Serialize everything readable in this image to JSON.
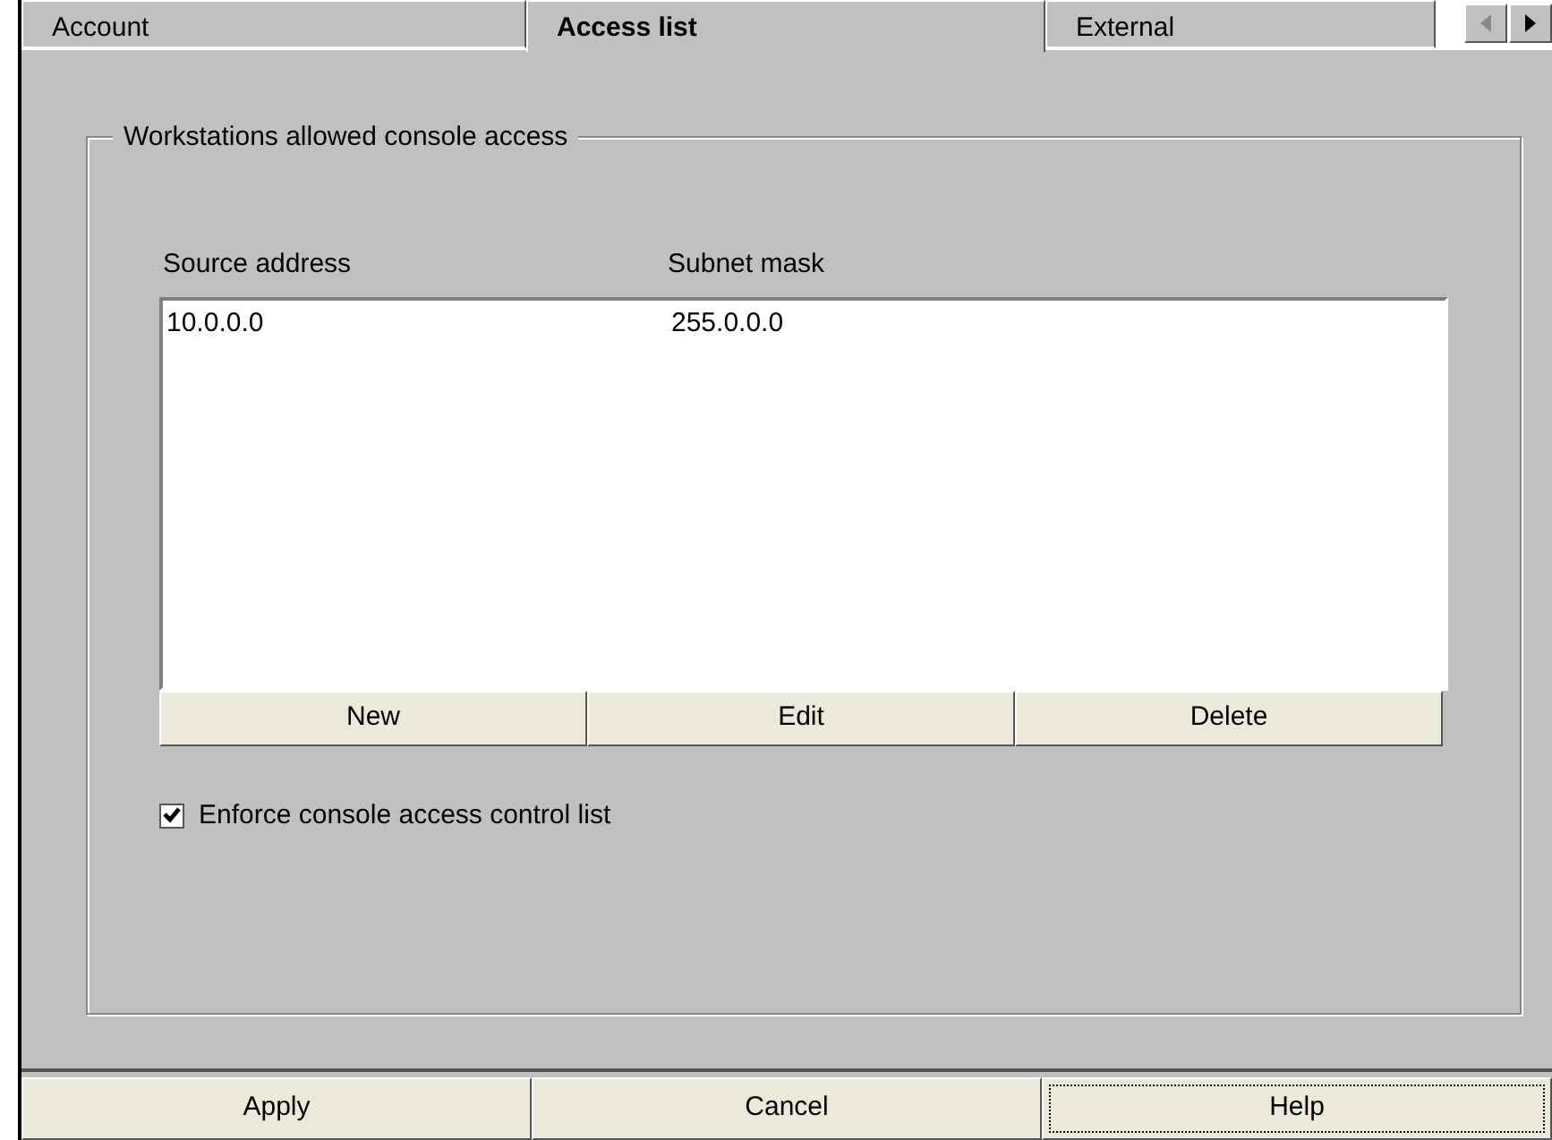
{
  "tabs": [
    {
      "label": "Account",
      "selected": false
    },
    {
      "label": "Access list",
      "selected": true
    },
    {
      "label": "External",
      "selected": false
    }
  ],
  "tab_scroll": {
    "left_disabled": true,
    "right_disabled": false
  },
  "group": {
    "title": "Workstations allowed console access",
    "table": {
      "columns": [
        "Source address",
        "Subnet mask"
      ],
      "rows": [
        [
          "10.0.0.0",
          "255.0.0.0"
        ]
      ]
    },
    "buttons": [
      "New",
      "Edit",
      "Delete"
    ],
    "checkbox": {
      "label": "Enforce console access control list",
      "checked": true
    }
  },
  "footer_buttons": [
    {
      "label": "Apply",
      "focused": false
    },
    {
      "label": "Cancel",
      "focused": false
    },
    {
      "label": "Help",
      "focused": true
    }
  ]
}
